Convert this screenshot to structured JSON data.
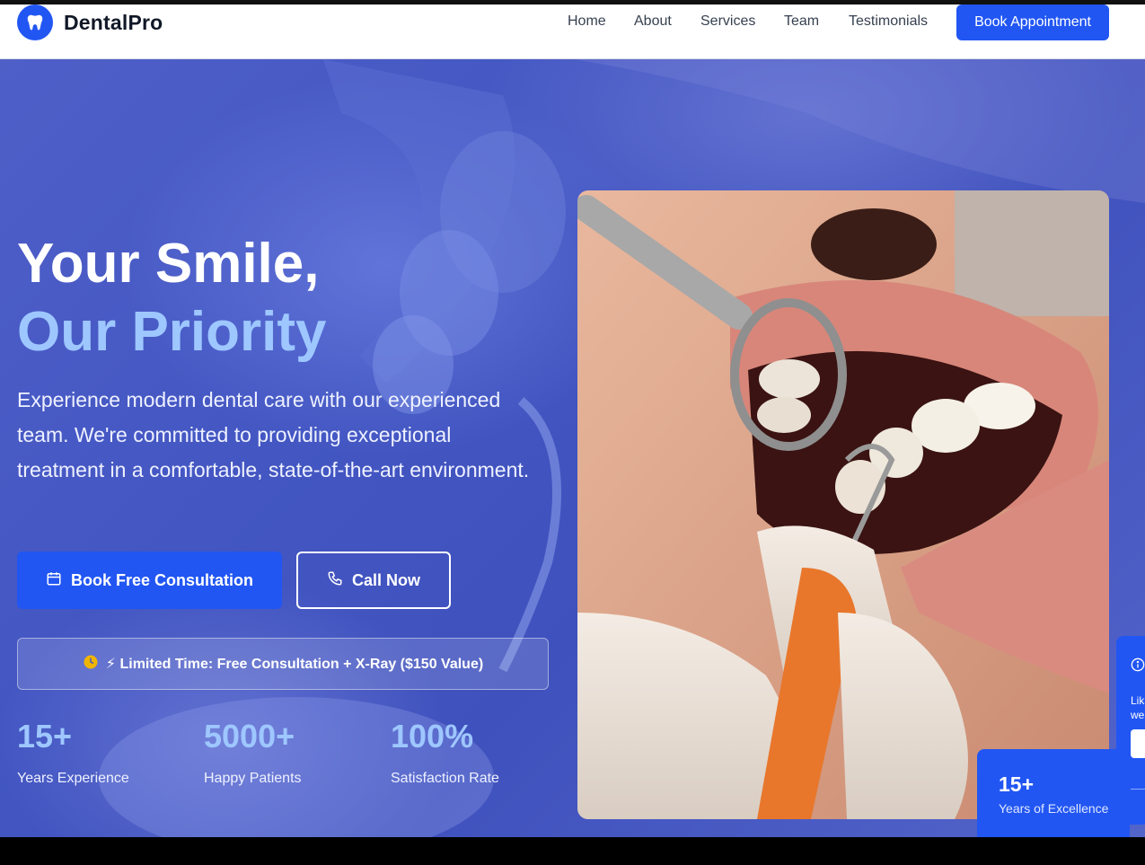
{
  "brand": {
    "name": "DentalPro",
    "accent_color": "#2156f3",
    "logo_icon": "tooth-icon"
  },
  "nav": {
    "links": [
      "Home",
      "About",
      "Services",
      "Team",
      "Testimonials"
    ],
    "cta_label": "Book Appointment"
  },
  "hero": {
    "title_line1": "Your Smile,",
    "title_line2": "Our Priority",
    "subtitle": "Experience modern dental care with our experienced team. We're committed to providing exceptional treatment in a comfortable, state-of-the-art environment.",
    "primary_button": "Book Free Consultation",
    "primary_button_icon": "calendar-icon",
    "secondary_button": "Call Now",
    "secondary_button_icon": "phone-icon",
    "promo_icon": "clock-icon",
    "promo_text": "⚡ Limited Time: Free Consultation + X-Ray ($150 Value)",
    "stats": [
      {
        "value": "15+",
        "label": "Years Experience"
      },
      {
        "value": "5000+",
        "label": "Happy Patients"
      },
      {
        "value": "100%",
        "label": "Satisfaction Rate"
      }
    ]
  },
  "experience_card": {
    "value": "15+",
    "label": "Years of Excellence"
  },
  "side_widget": {
    "icon": "info-icon",
    "text_line1": "Lik",
    "text_line2": "we"
  }
}
